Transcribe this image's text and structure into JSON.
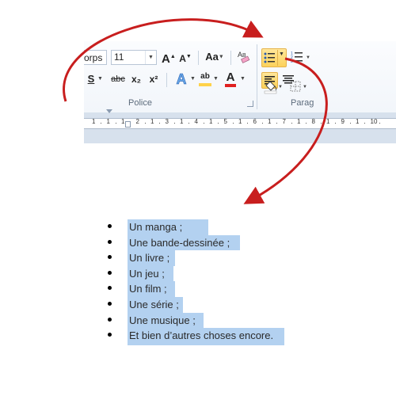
{
  "ribbon": {
    "font_name": "orps",
    "font_size": "11",
    "grow_font": "A",
    "shrink_font": "A",
    "change_case": "Aa",
    "clear_format_label": "A",
    "strikethrough": "abc",
    "subscript": "x₂",
    "superscript": "x²",
    "underline": "S",
    "text_effects": "A",
    "highlight": "ab",
    "font_color": "A",
    "group_font_label": "Police",
    "group_paragraph_label": "Parag",
    "highlight_color": "#ffd24a",
    "font_color_swatch": "#e02020",
    "ruler_numbers": [
      "1",
      "1",
      "1",
      "2",
      "1",
      "3",
      "1",
      "4",
      "1",
      "5",
      "1",
      "6",
      "1",
      "7",
      "1",
      "8",
      "1",
      "9",
      "1",
      "10"
    ]
  },
  "list": {
    "items": [
      "Un manga ;",
      "Une bande-dessinée ;",
      "Un livre  ;",
      "Un jeu ;",
      "Un film  ;",
      "Une série ;",
      "Une musique ;",
      "Et bien d’autres choses encore."
    ],
    "selection_color": "#b3d1f0"
  },
  "annotation": {
    "arrow_color": "#c81e1e"
  }
}
